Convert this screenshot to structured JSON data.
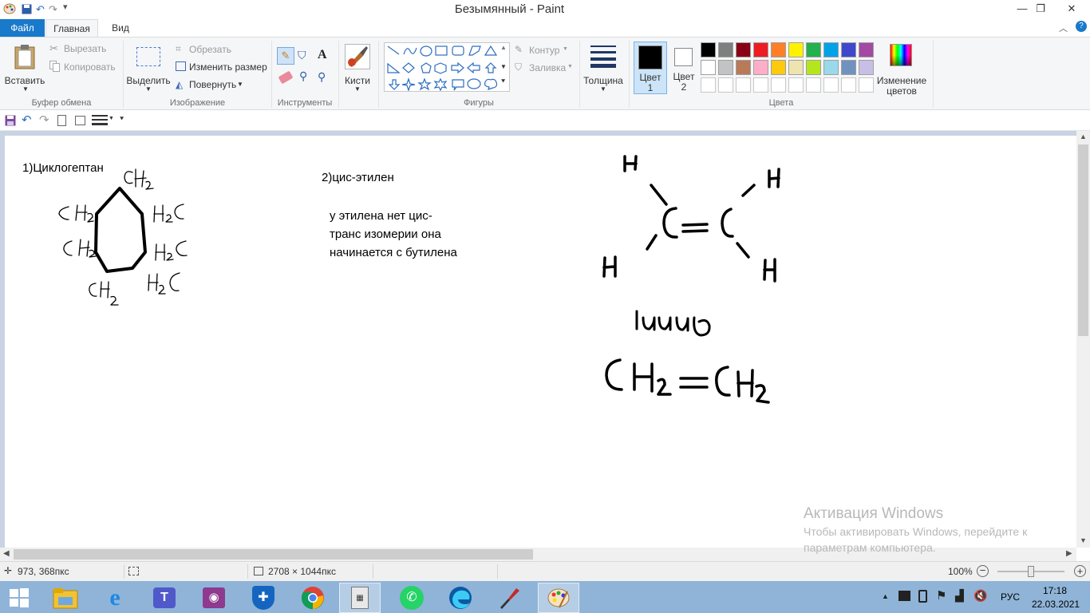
{
  "window": {
    "title": "Безымянный - Paint",
    "minimize": "—",
    "restore": "❐",
    "close": "✕"
  },
  "tabs": {
    "file": "Файл",
    "home": "Главная",
    "view": "Вид"
  },
  "ribbon": {
    "clipboard": {
      "paste": "Вставить",
      "cut": "Вырезать",
      "copy": "Копировать",
      "label": "Буфер обмена"
    },
    "image": {
      "select": "Выделить",
      "crop": "Обрезать",
      "resize": "Изменить размер",
      "rotate": "Повернуть",
      "label": "Изображение"
    },
    "tools": {
      "label": "Инструменты",
      "text_glyph": "A"
    },
    "brushes": {
      "label": "Кисти"
    },
    "shapes": {
      "outline": "Контур",
      "fill": "Заливка",
      "label": "Фигуры"
    },
    "size": {
      "label": "Толщина"
    },
    "colors": {
      "color1_line1": "Цвет",
      "color1_line2": "1",
      "color2_line1": "Цвет",
      "color2_line2": "2",
      "edit_line1": "Изменение",
      "edit_line2": "цветов",
      "label": "Цвета",
      "color1": "#000000",
      "color2": "#ffffff",
      "palette_row1": [
        "#000000",
        "#7f7f7f",
        "#880015",
        "#ed1c24",
        "#ff7f27",
        "#fff200",
        "#22b14c",
        "#00a2e8",
        "#3f48cc",
        "#a349a4"
      ],
      "palette_row2": [
        "#ffffff",
        "#c3c3c3",
        "#b97a57",
        "#ffaec9",
        "#ffc90e",
        "#efe4b0",
        "#b5e61d",
        "#99d9ea",
        "#7092be",
        "#c8bfe7"
      ]
    }
  },
  "canvas": {
    "text1": "1)Циклогептан",
    "text2": "2)цис-этилен",
    "note_line1": "у этилена нет цис-",
    "note_line2": "транс изомерии она",
    "note_line3": "начинается с бутилена"
  },
  "watermark": {
    "title": "Активация Windows",
    "line1": "Чтобы активировать Windows, перейдите к",
    "line2": "параметрам компьютера."
  },
  "status": {
    "cursor_pos": "973, 368пкс",
    "image_size": "2708 × 1044пкс",
    "zoom": "100%"
  },
  "taskbar": {
    "lang": "РУС",
    "time": "17:18",
    "date": "22.03.2021"
  }
}
